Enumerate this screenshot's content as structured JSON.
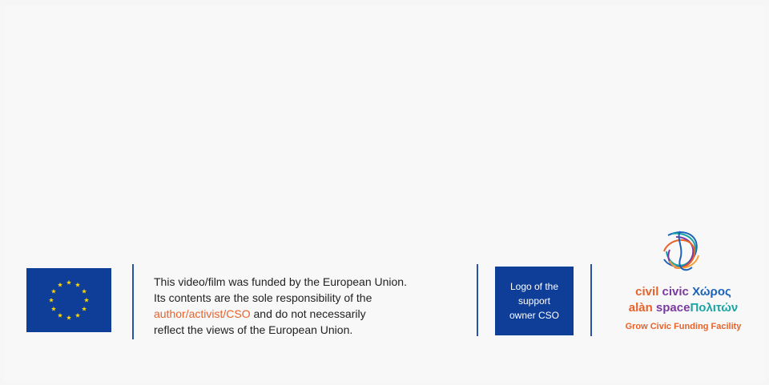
{
  "disclaimer": {
    "line1": "This video/film was funded by the European Union.",
    "line2": "Its contents are the sole responsibility of the",
    "line3_highlight": "author/activist/CSO",
    "line3_rest": " and do not necessarily",
    "line4": "reflect the views of the European Union."
  },
  "logo_placeholder": {
    "line1": "Logo of the",
    "line2": "support",
    "line3": "owner CSO"
  },
  "civic_logo": {
    "word_civil": "civil",
    "word_civic": "civic",
    "word_choros": "Χώρος",
    "word_alan": "alàn",
    "word_space": "space",
    "word_politon": "Πολιτών",
    "tagline": "Grow Civic Funding Facility"
  },
  "colors": {
    "eu_blue": "#0f3e99",
    "eu_star": "#ffd500",
    "accent_orange": "#e8622a",
    "purple": "#7a3aa0",
    "blue": "#1c63b7",
    "teal": "#1aa3a3"
  },
  "icons": [
    "eu-flag-icon",
    "civic-space-mark-icon"
  ]
}
